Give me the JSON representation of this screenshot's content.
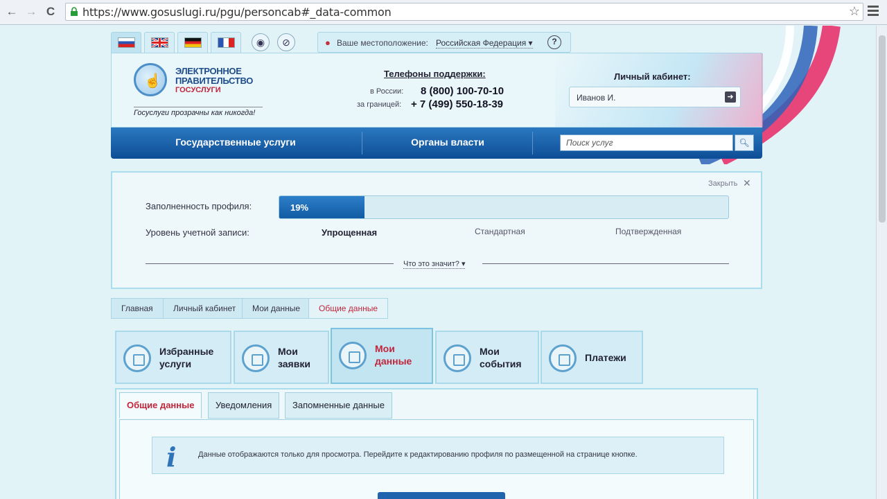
{
  "browser": {
    "url": "https://www.gosuslugi.ru/pgu/personcab#_data-common",
    "back_icon": "←",
    "forward_icon": "→",
    "reload_icon": "C",
    "star_icon": "☆"
  },
  "top_bar": {
    "location_label": "Ваше местоположение:",
    "location_value": "Российская Федерация ▾",
    "help": "?"
  },
  "header": {
    "logo_line1": "ЭЛЕКТРОННОЕ",
    "logo_line2": "ПРАВИТЕЛЬСТВО",
    "logo_line3": "ГОСУСЛУГИ",
    "slogan": "Госуслуги прозрачны как никогда!",
    "phones_title": "Телефоны поддержки:",
    "phone_russia_label": "в России:",
    "phone_russia": "8 (800) 100-70-10",
    "phone_abroad_label": "за границей:",
    "phone_abroad": "+ 7 (499) 550-18-39",
    "cabinet_title": "Личный кабинет:",
    "cabinet_user": "Иванов И."
  },
  "menu": {
    "item1": "Государственные услуги",
    "item2": "Органы власти",
    "search_placeholder": "Поиск услуг"
  },
  "profile": {
    "close": "Закрыть",
    "fill_label": "Заполненность профиля:",
    "fill_percent": 19,
    "fill_text": "19%",
    "level_label": "Уровень учетной записи:",
    "level_simplified": "Упрощенная",
    "level_standard": "Стандартная",
    "level_confirmed": "Подтвержденная",
    "what_link": "Что это значит? ▾"
  },
  "breadcrumbs": [
    "Главная",
    "Личный кабинет",
    "Мои данные",
    "Общие данные"
  ],
  "service_tabs": [
    {
      "line1": "Избранные",
      "line2": "услуги"
    },
    {
      "line1": "Мои",
      "line2": "заявки"
    },
    {
      "line1": "Мои",
      "line2": "данные"
    },
    {
      "line1": "Мои",
      "line2": "события"
    },
    {
      "line1": "Платежи",
      "line2": ""
    }
  ],
  "sub_tabs": [
    "Общие данные",
    "Уведомления",
    "Запомненные данные"
  ],
  "info": {
    "icon": "i",
    "text": "Данные отображаются только для просмотра. Перейдите к редактированию профиля по размещенной на странице кнопке."
  },
  "colors": {
    "accent_blue": "#0d4e96",
    "accent_red": "#c0253a",
    "progress_fill": "#125ba3"
  }
}
